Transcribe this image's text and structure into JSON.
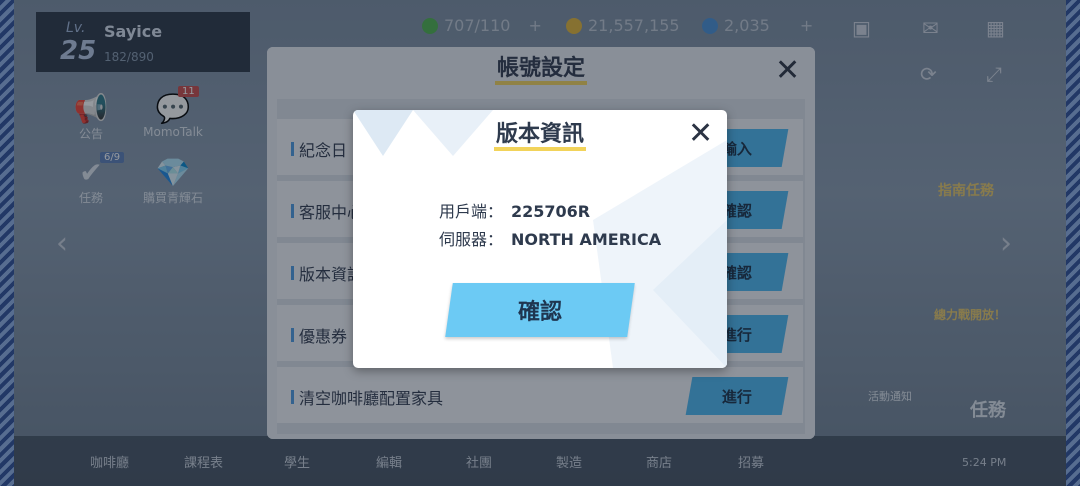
{
  "player": {
    "lv_label": "Lv.",
    "level": "25",
    "name": "Sayice",
    "exp": "182/890"
  },
  "resources": {
    "ap": "707/110",
    "credits": "21,557,155",
    "gems": "2,035",
    "plus": "+"
  },
  "left_menu": [
    {
      "label": "公告",
      "icon": "megaphone-icon"
    },
    {
      "label": "MomoTalk",
      "icon": "momotalk-icon",
      "badge": "11"
    },
    {
      "label": "任務",
      "icon": "task-icon",
      "badge": "6/9"
    },
    {
      "label": "購買青輝石",
      "icon": "gem-shop-icon"
    }
  ],
  "right_labels": {
    "guide": "指南任務",
    "power": "總力戰開放！",
    "mission": "任務",
    "event": "活動通知"
  },
  "bottom_nav": [
    "咖啡廳",
    "課程表",
    "學生",
    "編輯",
    "社團",
    "製造",
    "商店",
    "招募"
  ],
  "time": "5:24 PM",
  "account_panel": {
    "title": "帳號設定",
    "rows": [
      {
        "label": "紀念日",
        "button": "輸入"
      },
      {
        "label": "客服中心",
        "button": "確認"
      },
      {
        "label": "版本資訊",
        "button": "確認"
      },
      {
        "label": "優惠券",
        "button": "進行"
      },
      {
        "label": "清空咖啡廳配置家具",
        "button": "進行"
      }
    ]
  },
  "version_dialog": {
    "title": "版本資訊",
    "client_label": "用戶端：",
    "client_value": "225706R",
    "server_label": "伺服器：",
    "server_value": "NORTH AMERICA",
    "confirm": "確認"
  }
}
